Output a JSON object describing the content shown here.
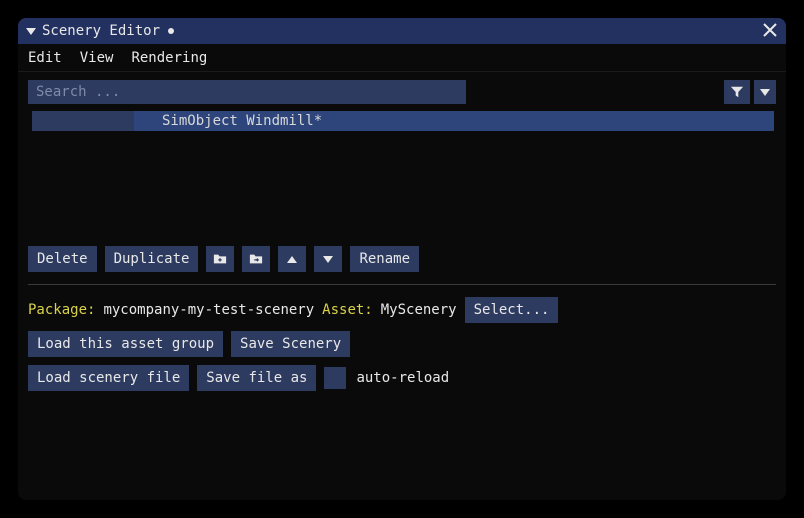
{
  "window": {
    "title": "Scenery Editor",
    "dirty": true
  },
  "menu": {
    "edit": "Edit",
    "view": "View",
    "rendering": "Rendering"
  },
  "search": {
    "placeholder": "Search ..."
  },
  "list": {
    "selected_item": "SimObject Windmill*"
  },
  "toolbar": {
    "delete": "Delete",
    "duplicate": "Duplicate",
    "rename": "Rename"
  },
  "info": {
    "package_label": "Package:",
    "package_value": "mycompany-my-test-scenery",
    "asset_label": "Asset:",
    "asset_value": "MyScenery",
    "select_button": "Select..."
  },
  "actions": {
    "load_asset_group": "Load this asset group",
    "save_scenery": "Save Scenery",
    "load_scenery_file": "Load scenery file",
    "save_file_as": "Save file as",
    "auto_reload_label": "auto-reload"
  }
}
